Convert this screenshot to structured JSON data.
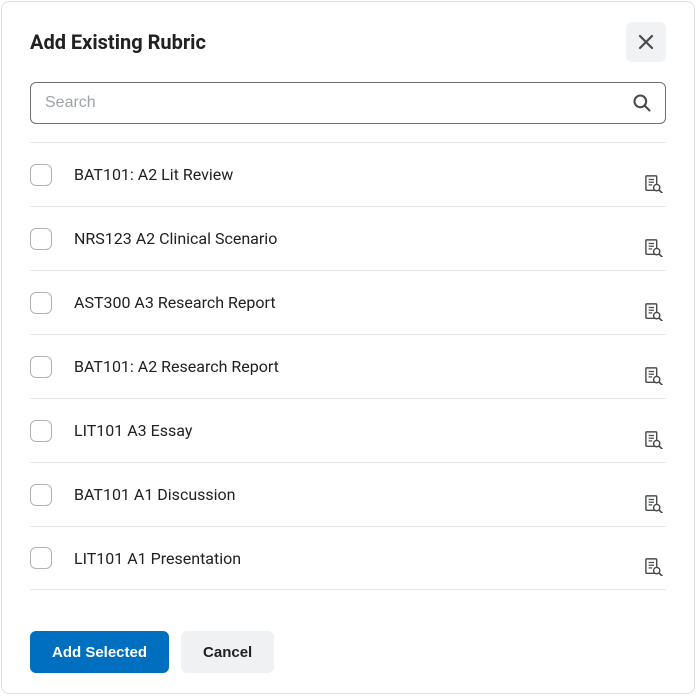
{
  "dialog": {
    "title": "Add Existing Rubric",
    "search_placeholder": "Search",
    "close_label": "Close",
    "add_button": "Add Selected",
    "cancel_button": "Cancel"
  },
  "rubrics": [
    {
      "label": "BAT101: A2 Lit Review",
      "checked": false
    },
    {
      "label": "NRS123 A2 Clinical Scenario",
      "checked": false
    },
    {
      "label": "AST300 A3 Research Report",
      "checked": false
    },
    {
      "label": "BAT101: A2 Research Report",
      "checked": false
    },
    {
      "label": "LIT101 A3 Essay",
      "checked": false
    },
    {
      "label": "BAT101 A1 Discussion",
      "checked": false
    },
    {
      "label": "LIT101 A1 Presentation",
      "checked": false
    }
  ]
}
